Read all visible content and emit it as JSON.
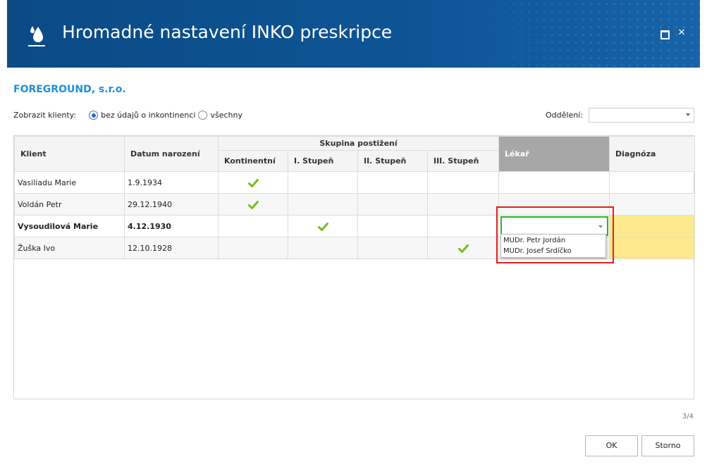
{
  "window": {
    "title": "Hromadné nastavení INKO preskripce",
    "icon": "water-drop-icon",
    "maximize_icon": "maximize-icon",
    "close_glyph": "✕"
  },
  "company": "FOREGROUND, s.r.o.",
  "filter": {
    "label": "Zobrazit klienty:",
    "options": [
      {
        "label": "bez údajů o inkontinenci",
        "selected": true
      },
      {
        "label": "všechny",
        "selected": false
      }
    ]
  },
  "department": {
    "label": "Oddělení:",
    "value": ""
  },
  "table": {
    "headers": {
      "client": "Klient",
      "birth": "Datum narození",
      "group": "Skupina postižení",
      "continent": "Kontinentní",
      "stage1": "I. Stupeň",
      "stage2": "II. Stupeň",
      "stage3": "III. Stupeň",
      "doctor": "Lékař",
      "diagnosis": "Diagnóza"
    },
    "rows": [
      {
        "client": "Vasiliadu Marie",
        "birth": "1.9.1934",
        "group": "continent",
        "doctor": "",
        "diagnosis": ""
      },
      {
        "client": "Voldán Petr",
        "birth": "29.12.1940",
        "group": "continent",
        "doctor": "",
        "diagnosis": ""
      },
      {
        "client": "Vysoudilová Marie",
        "birth": "4.12.1930",
        "group": "stage1",
        "doctor": "",
        "diagnosis": ""
      },
      {
        "client": "Žuška Ivo",
        "birth": "12.10.1928",
        "group": "stage3",
        "doctor": "",
        "diagnosis": ""
      }
    ],
    "selected_row": 2
  },
  "doctor_dropdown": {
    "options": [
      "MUDr. Petr Jordán",
      "MUDr. Josef Srdíčko"
    ]
  },
  "pager": "3/4",
  "buttons": {
    "ok": "OK",
    "cancel": "Storno"
  },
  "colors": {
    "titlebar": "#0d4f8b",
    "company": "#1f8fd6",
    "check": "#6fbf1e",
    "highlight": "#e41e1e",
    "focus": "#2bb52b",
    "diagnosis_fill": "#fde98c"
  }
}
